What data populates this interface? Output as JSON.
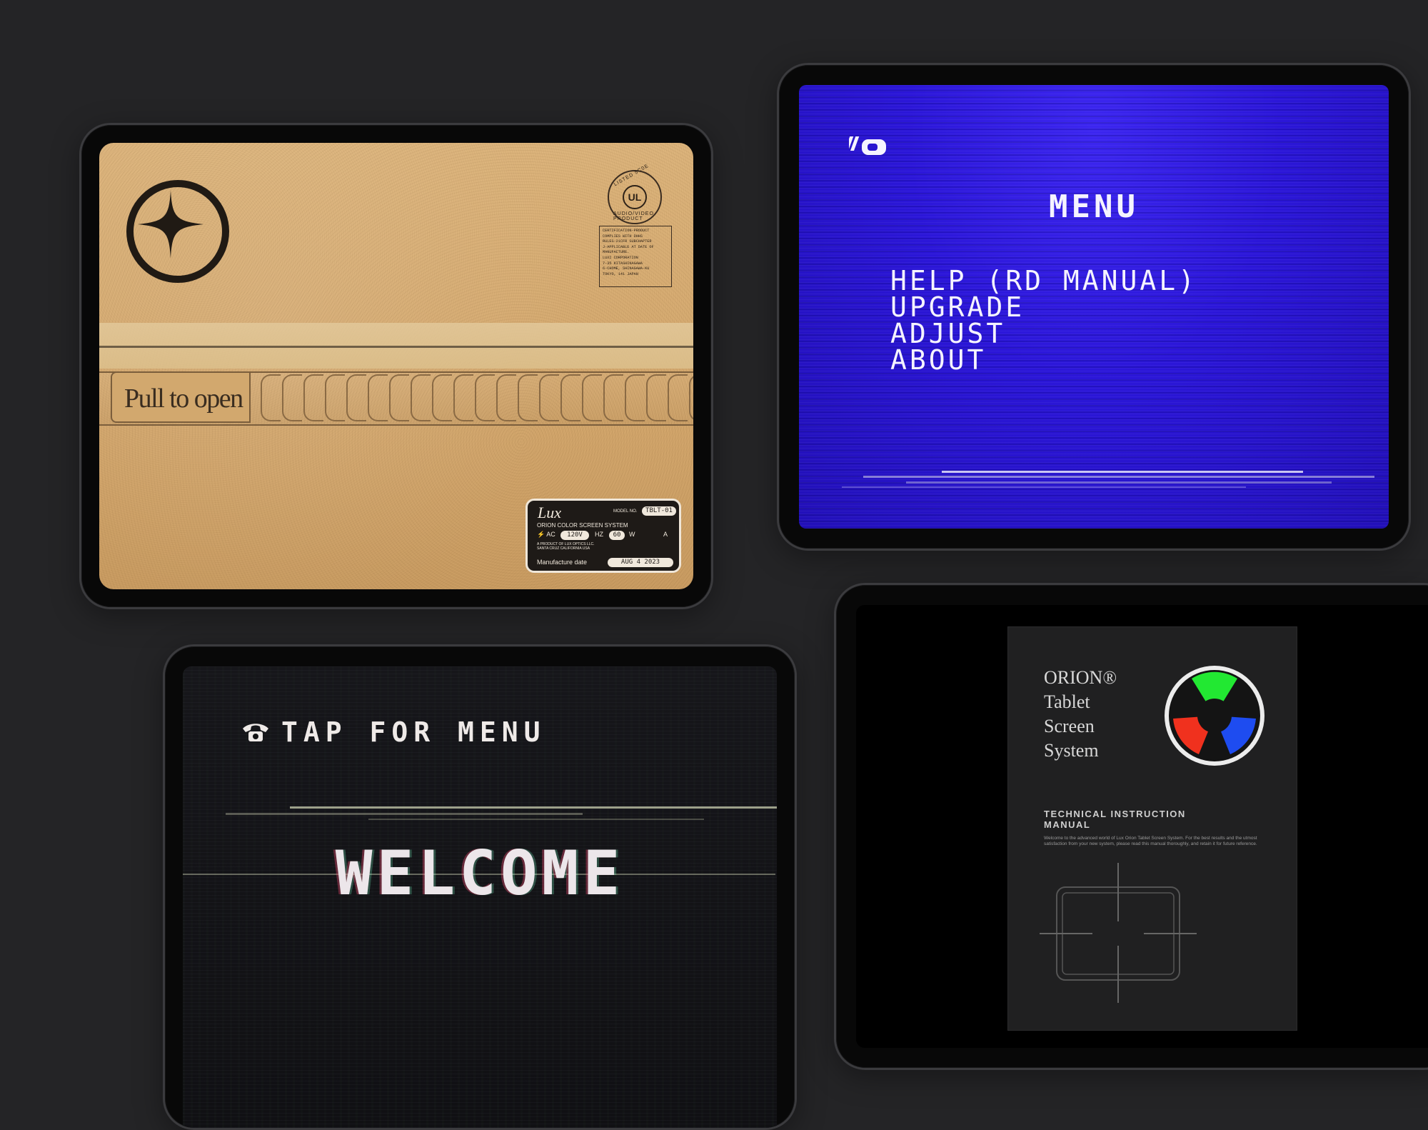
{
  "cardboard": {
    "pull_label": "Pull to open",
    "ul_seal": {
      "mark": "UL",
      "top_text": "LISTED 5C0E",
      "bottom_text": "AUDIO/VIDEO PRODUCT"
    },
    "certification_lines": [
      "CERTIFICATION-PRODUCT",
      "COMPLIES WITH DHHS",
      "RULES-21CFR SUBCHAPTER",
      "J-APPLICABLE AT DATE OF",
      "MANUFACTURE.",
      "LUXI CORPORATION",
      "7-35 KITASHINAGAWA",
      "6-CHOME, SHINAGAWA-KU",
      "TOKYO, 141 JAPAN"
    ],
    "rating_label": {
      "brand": "Lux",
      "model_key": "MODEL NO.",
      "model_value": "TBLT-01",
      "system": "ORION COLOR SCREEN SYSTEM",
      "ac_key": "AC",
      "ac_value": "120V",
      "hz_key": "HZ",
      "hz_value": "60",
      "w_key": "W",
      "a_key": "A",
      "product_of": "A PRODUCT OF LUX OPTICS LLC.",
      "location": "SANTA CRUZ CALIFORNIA USA",
      "date_key": "Manufacture date",
      "date_value": "AUG 4 2023"
    }
  },
  "menu_screen": {
    "title": "MENU",
    "items": [
      "HELP (RD MANUAL)",
      "UPGRADE",
      "ADJUST",
      "ABOUT"
    ]
  },
  "welcome_screen": {
    "tap_label": "TAP FOR MENU",
    "welcome": "WELCOME"
  },
  "manual": {
    "brand_lines": [
      "ORION®",
      "Tablet",
      "Screen",
      "System"
    ],
    "heading_line1": "TECHNICAL INSTRUCTION",
    "heading_line2": "MANUAL",
    "description": "Welcome to the advanced world of Lux Orion Tablet Screen System. For the best results and the utmost satisfaction from your new system, please read this manual thoroughly, and retain it for future reference.",
    "logo_colors": [
      "#22e832",
      "#f0311e",
      "#1e4cf0"
    ]
  },
  "icons": {
    "brand_logo": "circle-star-icon",
    "vcr": "vcr-icon",
    "phone": "telephone-icon",
    "crosshair": "crosshair-screen-icon"
  }
}
